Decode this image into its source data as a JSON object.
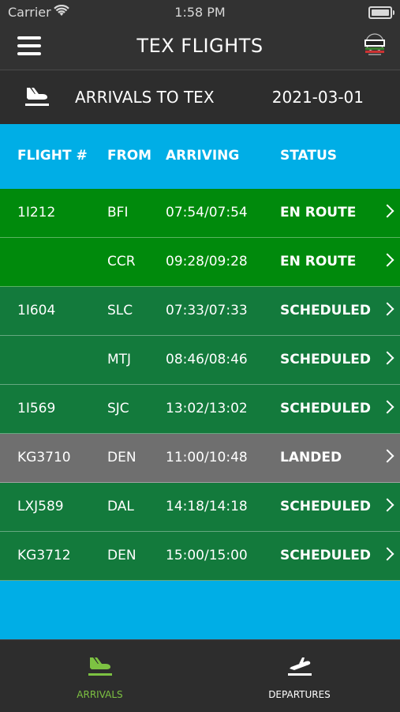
{
  "status_bar": {
    "carrier": "Carrier",
    "time": "1:58 PM"
  },
  "navbar": {
    "title": "TEX FLIGHTS",
    "menu_icon": "hamburger-menu-icon",
    "logo_icon": "news-logo-icon"
  },
  "subheader": {
    "title": "ARRIVALS TO TEX",
    "date": "2021-03-01",
    "icon": "airplane-arrival-icon"
  },
  "table": {
    "headers": {
      "flight": "FLIGHT #",
      "from": "FROM",
      "arriving": "ARRIVING",
      "status": "STATUS"
    },
    "rows": [
      {
        "flight": "1I212",
        "from": "BFI",
        "arriving": "07:54/07:54",
        "status": "EN ROUTE",
        "color": "#008a0c"
      },
      {
        "flight": "",
        "from": "CCR",
        "arriving": "09:28/09:28",
        "status": "EN ROUTE",
        "color": "#008a0c"
      },
      {
        "flight": "1I604",
        "from": "SLC",
        "arriving": "07:33/07:33",
        "status": "SCHEDULED",
        "color": "#137a3c"
      },
      {
        "flight": "",
        "from": "MTJ",
        "arriving": "08:46/08:46",
        "status": "SCHEDULED",
        "color": "#137a3c"
      },
      {
        "flight": "1I569",
        "from": "SJC",
        "arriving": "13:02/13:02",
        "status": "SCHEDULED",
        "color": "#137a3c"
      },
      {
        "flight": "KG3710",
        "from": "DEN",
        "arriving": "11:00/10:48",
        "status": "LANDED",
        "color": "#6f6f6f"
      },
      {
        "flight": "LXJ589",
        "from": "DAL",
        "arriving": "14:18/14:18",
        "status": "SCHEDULED",
        "color": "#137a3c"
      },
      {
        "flight": "KG3712",
        "from": "DEN",
        "arriving": "15:00/15:00",
        "status": "SCHEDULED",
        "color": "#137a3c"
      }
    ]
  },
  "tabs": [
    {
      "label": "ARRIVALS",
      "icon": "airplane-arrival-icon",
      "active": true,
      "color": "#7dc242"
    },
    {
      "label": "DEPARTURES",
      "icon": "airplane-departure-icon",
      "active": false,
      "color": "#ffffff"
    }
  ],
  "colors": {
    "header_bg": "#00aee6",
    "bar_bg": "#2d2d2d"
  }
}
